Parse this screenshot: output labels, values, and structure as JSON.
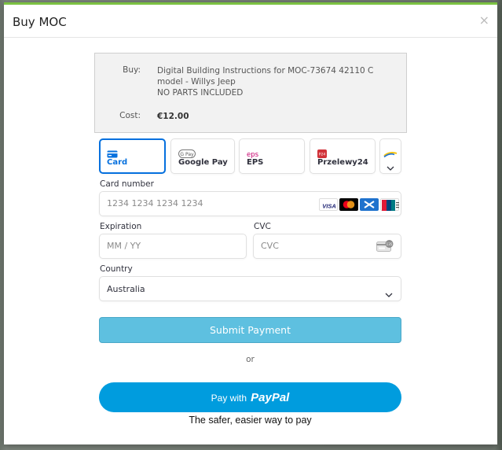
{
  "modal": {
    "title": "Buy MOC",
    "close_glyph": "×"
  },
  "summary": {
    "buy_label": "Buy:",
    "buy_line1": "Digital Building Instructions for MOC-73674 42110 C model - Willys Jeep",
    "buy_line2": "NO PARTS INCLUDED",
    "cost_label": "Cost:",
    "cost_value": "€12.00"
  },
  "payment_methods": [
    {
      "label": "Card",
      "icon": "credit-card-icon",
      "active": true
    },
    {
      "label": "Google Pay",
      "icon": "google-pay-icon",
      "icon_text": "G Pay",
      "active": false
    },
    {
      "label": "EPS",
      "icon": "eps-icon",
      "icon_text": "eps",
      "active": false
    },
    {
      "label": "Przelewy24",
      "icon": "p24-icon",
      "icon_text": "P24",
      "active": false
    },
    {
      "label": "",
      "icon": "more-methods-icon",
      "active": false
    }
  ],
  "card_form": {
    "card_number_label": "Card number",
    "card_number_placeholder": "1234 1234 1234 1234",
    "expiration_label": "Expiration",
    "expiration_placeholder": "MM / YY",
    "cvc_label": "CVC",
    "cvc_placeholder": "CVC",
    "cvc_icon_text": "135",
    "country_label": "Country",
    "country_value": "Australia",
    "card_brands": [
      "visa-logo",
      "mastercard-logo",
      "amex-logo",
      "unionpay-logo"
    ],
    "visa_text": "VISA"
  },
  "actions": {
    "submit_label": "Submit Payment",
    "or_text": "or",
    "paypal_paywith": "Pay with",
    "paypal_brand_pay": "Pay",
    "paypal_brand_pal": "Pal",
    "paypal_tagline": "The safer, easier way to pay"
  },
  "colors": {
    "accent_green": "#7cc242",
    "stripe_blue": "#0570de",
    "submit_bg": "#5ec0e0",
    "paypal_blue": "#009cde"
  }
}
